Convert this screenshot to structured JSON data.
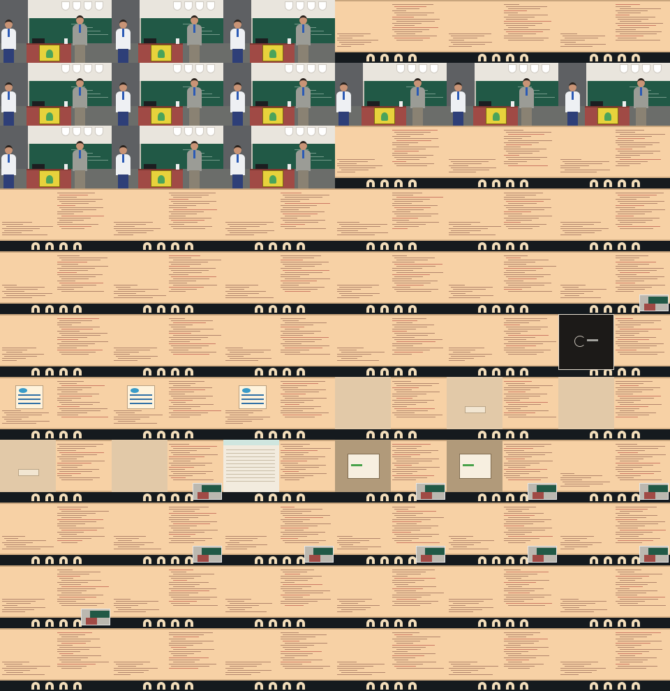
{
  "sheet": {
    "columns": 6,
    "rows": 11,
    "frames": [
      "stage",
      "stage",
      "stage",
      "screen",
      "screen",
      "screen",
      "stage",
      "stage",
      "stage",
      "stage",
      "stage",
      "stage",
      "stage",
      "stage",
      "stage",
      "screen",
      "screen",
      "screen",
      "screen",
      "screen",
      "screen",
      "screen",
      "screen",
      "screen",
      "screen",
      "screen",
      "screen",
      "screen",
      "screen",
      "screen-pip",
      "screen",
      "screen",
      "screen",
      "screen",
      "screen",
      "screen-black-slide",
      "screen-dialog",
      "screen-dialog",
      "screen-dialog",
      "screen-grey-left",
      "screen-grey-left",
      "screen-grey-left",
      "screen-grey-left",
      "screen-grey-left-pip",
      "screen-browser",
      "screen-browser-dialog-pip",
      "screen-browser-dialog-pip",
      "screen-pip",
      "screen",
      "screen-pip",
      "screen-pip",
      "screen-pip",
      "screen-pip",
      "screen-pip",
      "screen-pip",
      "screen",
      "screen",
      "screen",
      "screen",
      "screen",
      "screen",
      "screen",
      "screen",
      "screen",
      "screen",
      "screen"
    ]
  },
  "colors": {
    "code_panel": "#f7d1a5",
    "code_text": "#7f463c",
    "stage_board": "#215946",
    "podium": "#a04a45",
    "poster": "#e7d23c",
    "monitor_base": "#151a1e"
  }
}
